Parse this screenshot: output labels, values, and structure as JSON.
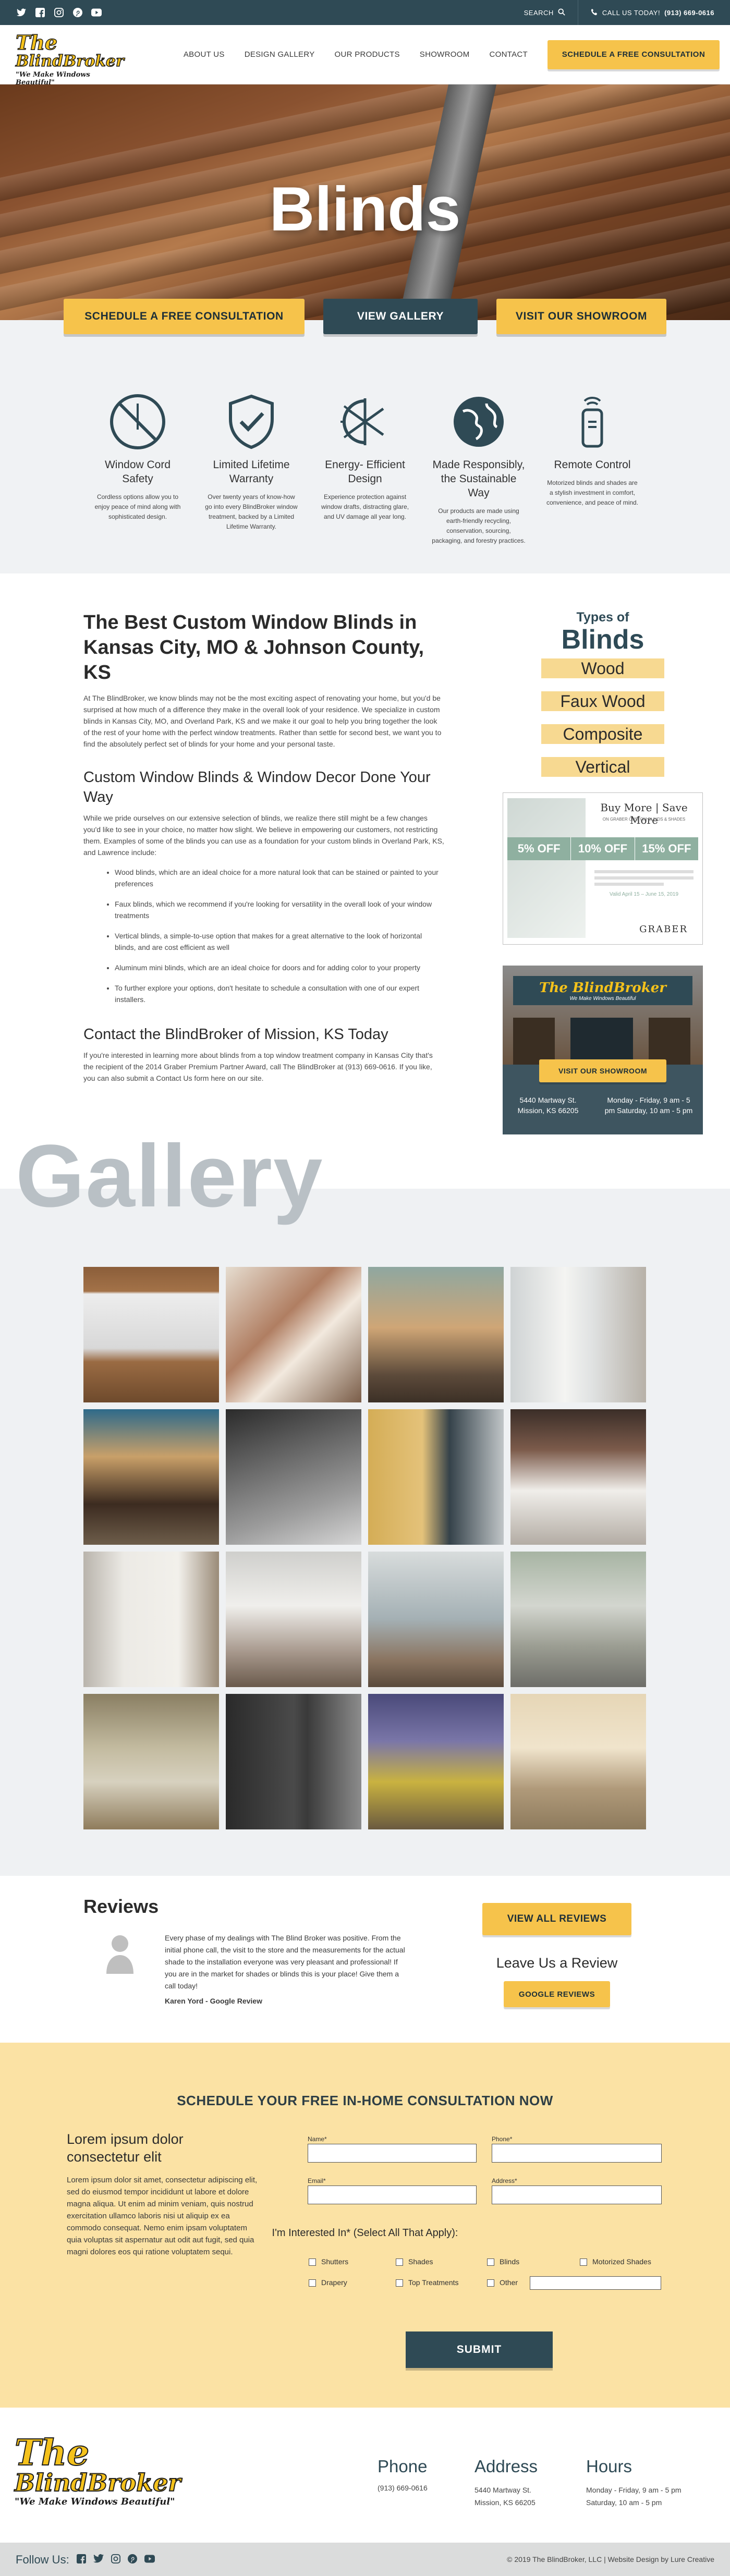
{
  "topbar": {
    "social": [
      "twitter-icon",
      "facebook-icon",
      "instagram-icon",
      "pinterest-icon",
      "youtube-icon"
    ],
    "search_label": "SEARCH",
    "call_label": "CALL US TODAY!",
    "call_number": "(913) 669-0616"
  },
  "logo": {
    "line1": "The",
    "line2": "BlindBroker",
    "tagline": "\"We Make Windows Beautiful\""
  },
  "nav": {
    "items": [
      "ABOUT US",
      "DESIGN GALLERY",
      "OUR PRODUCTS",
      "SHOWROOM",
      "CONTACT"
    ],
    "cta": "SCHEDULE A FREE CONSULTATION"
  },
  "hero": {
    "title": "Blinds",
    "buttons": [
      "SCHEDULE A FREE CONSULTATION",
      "VIEW GALLERY",
      "VISIT OUR SHOWROOM"
    ]
  },
  "features": [
    {
      "icon": "no-cord-icon",
      "title": "Window Cord Safety",
      "text": "Cordless options allow you to enjoy peace of mind along with sophisticated design."
    },
    {
      "icon": "shield-check-icon",
      "title": "Limited Lifetime Warranty",
      "text": "Over twenty years of know-how go into every BlindBroker window treatment, backed by a Limited Lifetime Warranty."
    },
    {
      "icon": "sun-snowflake-icon",
      "title": "Energy- Efficient Design",
      "text": "Experience protection against window drafts, distracting glare, and UV damage all year long."
    },
    {
      "icon": "globe-icon",
      "title": "Made Responsibly, the Sustainable Way",
      "text": "Our products are made using earth-friendly recycling, conservation, sourcing, packaging, and forestry practices."
    },
    {
      "icon": "remote-icon",
      "title": "Remote Control",
      "text": "Motorized blinds and shades are a stylish investment in comfort, convenience, and peace of mind."
    }
  ],
  "content": {
    "h1": "The Best Custom Window Blinds in Kansas City, MO & Johnson County, KS",
    "p1": "At The BlindBroker, we know blinds may not be the most exciting aspect of renovating your home, but you'd be surprised at how much of a difference they make in the overall look of your residence. We specialize in custom blinds in Kansas City, MO, and Overland Park, KS and we make it our goal to help you bring together the look of the rest of your home with the perfect window treatments. Rather than settle for second best, we want you to find the absolutely perfect set of blinds for your home and your personal taste.",
    "h2": "Custom Window Blinds & Window Decor Done Your Way",
    "p2": "While we pride ourselves on our extensive selection of blinds, we realize there still might be a few changes you'd like to see in your choice, no matter how slight. We believe in empowering our customers, not restricting them. Examples of some of the blinds you can use as a foundation for your custom blinds in Overland Park, KS, and Lawrence include:",
    "list": [
      "Wood blinds, which are an ideal choice for a more natural look that can be stained or painted to your preferences",
      "Faux blinds, which we recommend if you're looking for versatility in the overall look of your window treatments",
      "Vertical blinds, a simple-to-use option that makes for a great alternative to the look of horizontal blinds, and are cost efficient as well",
      "Aluminum mini blinds, which are an ideal choice for doors and for adding color to your property",
      "To further explore your options, don't hesitate to schedule a consultation with one of our expert installers."
    ],
    "h3": "Contact the BlindBroker of Mission, KS Today",
    "p3": "If you're interested in learning more about blinds from a top window treatment company in Kansas City that's the recipient of the 2014 Graber Premium Partner Award, call The BlindBroker at (913) 669-0616. If you like, you can also submit a Contact Us form here on our site."
  },
  "types": {
    "small": "Types of",
    "big": "Blinds",
    "items": [
      "Wood",
      "Faux Wood",
      "Composite",
      "Vertical"
    ]
  },
  "promo": {
    "title": "Buy More | Save More",
    "sub": "ON GRABER CUSTOM BLINDS & SHADES",
    "offers": [
      "5% OFF",
      "10% OFF",
      "15% OFF"
    ],
    "dates": "Valid April 15 – June 15, 2019",
    "brand": "GRABER"
  },
  "showroom_ad": {
    "logo": "The BlindBroker",
    "tagline": "We Make Windows Beautiful",
    "button": "VISIT OUR SHOWROOM",
    "address": "5440 Martway St. Mission, KS 66205",
    "hours": "Monday - Friday, 9 am - 5 pm Saturday, 10 am - 5 pm"
  },
  "gallery": {
    "title": "Gallery"
  },
  "reviews": {
    "title": "Reviews",
    "text": "Every phase of my dealings with The Blind Broker was positive. From the initial phone call, the visit to the store and the measurements for the actual shade to the installation everyone was very pleasant and professional! If you are in the market for shades or blinds this is your place! Give them a call today!",
    "author": "Karen Yord - Google Review",
    "all_btn": "VIEW ALL REVIEWS",
    "leave": "Leave Us a Review",
    "google_btn": "GOOGLE REVIEWS"
  },
  "consult": {
    "title": "SCHEDULE YOUR FREE IN-HOME CONSULTATION NOW",
    "lorem_title": "Lorem ipsum dolor consectetur elit",
    "lorem": "Lorem ipsum dolor sit amet, consectetur adipiscing elit, sed do eiusmod tempor incididunt ut labore et dolore magna aliqua. Ut enim ad minim veniam, quis nostrud exercitation ullamco laboris nisi ut aliquip ex ea commodo consequat. Nemo enim ipsam voluptatem quia voluptas sit aspernatur aut odit aut fugit, sed quia magni dolores eos qui ratione voluptatem sequi.",
    "labels": [
      "Name*",
      "Phone*",
      "Email*",
      "Address*"
    ],
    "interest": "I'm Interested In* (Select All That Apply):",
    "options": [
      "Shutters",
      "Shades",
      "Blinds",
      "Motorized Shades",
      "Drapery",
      "Top Treatments",
      "Other"
    ],
    "submit": "SUBMIT"
  },
  "footer": {
    "phone_h": "Phone",
    "phone": "(913) 669-0616",
    "address_h": "Address",
    "address": "5440 Martway St. Mission, KS 66205",
    "hours_h": "Hours",
    "hours": "Monday - Friday, 9 am - 5 pm Saturday, 10 am - 5 pm",
    "follow": "Follow Us:",
    "copyright": "© 2019 The BlindBroker, LLC | Website Design by Lure Creative"
  }
}
